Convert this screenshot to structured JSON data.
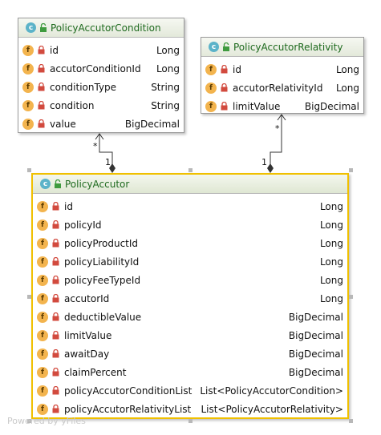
{
  "classes": {
    "condition": {
      "badge": "c",
      "name": "PolicyAccutorCondition",
      "fields": [
        {
          "badge": "f",
          "name": "id",
          "type": "Long"
        },
        {
          "badge": "f",
          "name": "accutorConditionId",
          "type": "Long"
        },
        {
          "badge": "f",
          "name": "conditionType",
          "type": "String"
        },
        {
          "badge": "f",
          "name": "condition",
          "type": "String"
        },
        {
          "badge": "f",
          "name": "value",
          "type": "BigDecimal"
        }
      ]
    },
    "relativity": {
      "badge": "c",
      "name": "PolicyAccutorRelativity",
      "fields": [
        {
          "badge": "f",
          "name": "id",
          "type": "Long"
        },
        {
          "badge": "f",
          "name": "accutorRelativityId",
          "type": "Long"
        },
        {
          "badge": "f",
          "name": "limitValue",
          "type": "BigDecimal"
        }
      ]
    },
    "accutor": {
      "badge": "c",
      "name": "PolicyAccutor",
      "fields": [
        {
          "badge": "f",
          "name": "id",
          "type": "Long"
        },
        {
          "badge": "f",
          "name": "policyId",
          "type": "Long"
        },
        {
          "badge": "f",
          "name": "policyProductId",
          "type": "Long"
        },
        {
          "badge": "f",
          "name": "policyLiabilityId",
          "type": "Long"
        },
        {
          "badge": "f",
          "name": "policyFeeTypeId",
          "type": "Long"
        },
        {
          "badge": "f",
          "name": "accutorId",
          "type": "Long"
        },
        {
          "badge": "f",
          "name": "deductibleValue",
          "type": "BigDecimal"
        },
        {
          "badge": "f",
          "name": "limitValue",
          "type": "BigDecimal"
        },
        {
          "badge": "f",
          "name": "awaitDay",
          "type": "BigDecimal"
        },
        {
          "badge": "f",
          "name": "claimPercent",
          "type": "BigDecimal"
        },
        {
          "badge": "f",
          "name": "policyAccutorConditionList",
          "type": "List<PolicyAccutorCondition>"
        },
        {
          "badge": "f",
          "name": "policyAccutorRelativityList",
          "type": "List<PolicyAccutorRelativity>"
        }
      ]
    }
  },
  "edges": {
    "condition": {
      "source_mult": "1",
      "target_mult": "*"
    },
    "relativity": {
      "source_mult": "1",
      "target_mult": "*"
    }
  },
  "colors": {
    "class_name": "#1e6a1e",
    "class_badge": "#5cb3c9",
    "field_badge": "#f3b44e",
    "lock": "#d24a3e",
    "selection": "#f0c000"
  },
  "watermark": "Powered by yFiles"
}
